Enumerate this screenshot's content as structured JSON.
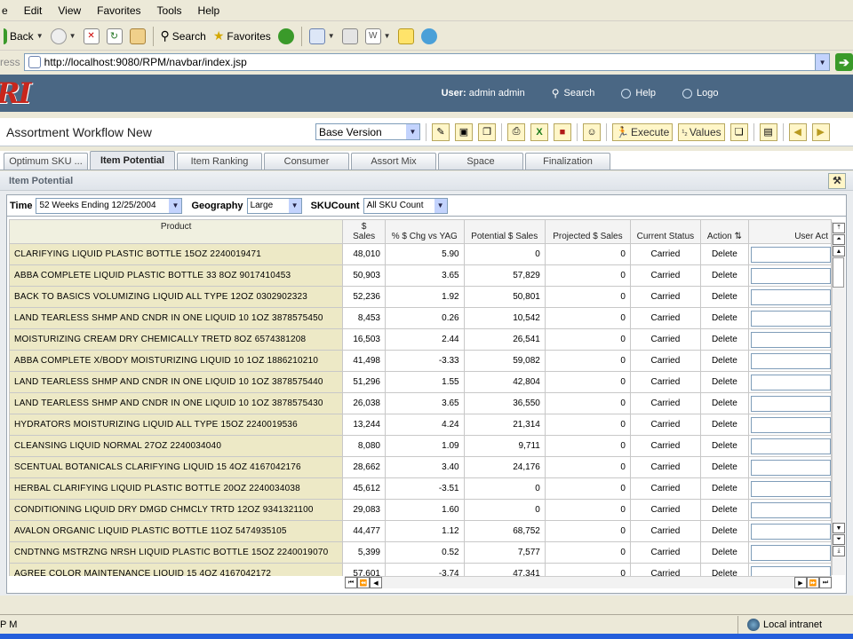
{
  "menu": [
    "e",
    "Edit",
    "View",
    "Favorites",
    "Tools",
    "Help"
  ],
  "toolbar": {
    "back": "Back",
    "search": "Search",
    "favorites": "Favorites"
  },
  "address": {
    "label": "ress",
    "url": "http://localhost:9080/RPM/navbar/index.jsp"
  },
  "header": {
    "logo": "RI",
    "user_label": "User:",
    "user_name": "admin admin",
    "search": "Search",
    "help": "Help",
    "logout": "Logo"
  },
  "title": "Assortment Workflow New",
  "version": "Base Version",
  "buttons": {
    "execute": "Execute",
    "values": "Values"
  },
  "tabs": [
    "Optimum SKU ...",
    "Item Potential",
    "Item Ranking",
    "Consumer",
    "Assort Mix",
    "Space",
    "Finalization"
  ],
  "active_tab": "Item Potential",
  "section_title": "Item Potential",
  "filters": {
    "time_label": "Time",
    "time_value": "52 Weeks Ending 12/25/2004",
    "geo_label": "Geography",
    "geo_value": "Large",
    "sku_label": "SKUCount",
    "sku_value": "All SKU Count"
  },
  "columns": {
    "product": "Product",
    "sales_top": "$",
    "sales_bottom": "Sales",
    "chg": "% $ Chg vs YAG",
    "potential": "Potential $ Sales",
    "projected": "Projected $ Sales",
    "status": "Current Status",
    "action": "Action",
    "user_action": "User Act"
  },
  "rows": [
    [
      "CLARIFYING LIQUID PLASTIC BOTTLE 15OZ 2240019471",
      "48,010",
      "5.90",
      "0",
      "0",
      "Carried",
      "Delete"
    ],
    [
      "ABBA COMPLETE LIQUID PLASTIC BOTTLE 33 8OZ 9017410453",
      "50,903",
      "3.65",
      "57,829",
      "0",
      "Carried",
      "Delete"
    ],
    [
      "BACK TO BASICS VOLUMIZING LIQUID ALL TYPE 12OZ 0302902323",
      "52,236",
      "1.92",
      "50,801",
      "0",
      "Carried",
      "Delete"
    ],
    [
      "LAND TEARLESS SHMP AND CNDR IN ONE LIQUID 10 1OZ 3878575450",
      "8,453",
      "0.26",
      "10,542",
      "0",
      "Carried",
      "Delete"
    ],
    [
      "MOISTURIZING CREAM DRY CHEMICALLY TRETD 8OZ 6574381208",
      "16,503",
      "2.44",
      "26,541",
      "0",
      "Carried",
      "Delete"
    ],
    [
      "ABBA COMPLETE X/BODY MOISTURIZING LIQUID 10 1OZ 1886210210",
      "41,498",
      "-3.33",
      "59,082",
      "0",
      "Carried",
      "Delete"
    ],
    [
      "LAND TEARLESS SHMP AND CNDR IN ONE LIQUID 10 1OZ 3878575440",
      "51,296",
      "1.55",
      "42,804",
      "0",
      "Carried",
      "Delete"
    ],
    [
      "LAND TEARLESS SHMP AND CNDR IN ONE LIQUID 10 1OZ 3878575430",
      "26,038",
      "3.65",
      "36,550",
      "0",
      "Carried",
      "Delete"
    ],
    [
      "HYDRATORS MOISTURIZING LIQUID ALL TYPE 15OZ 2240019536",
      "13,244",
      "4.24",
      "21,314",
      "0",
      "Carried",
      "Delete"
    ],
    [
      "CLEANSING LIQUID NORMAL 27OZ 2240034040",
      "8,080",
      "1.09",
      "9,711",
      "0",
      "Carried",
      "Delete"
    ],
    [
      "SCENTUAL BOTANICALS CLARIFYING LIQUID 15 4OZ 4167042176",
      "28,662",
      "3.40",
      "24,176",
      "0",
      "Carried",
      "Delete"
    ],
    [
      "HERBAL CLARIFYING LIQUID PLASTIC BOTTLE 20OZ 2240034038",
      "45,612",
      "-3.51",
      "0",
      "0",
      "Carried",
      "Delete"
    ],
    [
      "CONDITIONING LIQUID DRY DMGD CHMCLY TRTD 12OZ 9341321100",
      "29,083",
      "1.60",
      "0",
      "0",
      "Carried",
      "Delete"
    ],
    [
      "AVALON ORGANIC LIQUID PLASTIC BOTTLE 11OZ 5474935105",
      "44,477",
      "1.12",
      "68,752",
      "0",
      "Carried",
      "Delete"
    ],
    [
      "CNDTNNG MSTRZNG NRSH LIQUID PLASTIC BOTTLE 15OZ 2240019070",
      "5,399",
      "0.52",
      "7,577",
      "0",
      "Carried",
      "Delete"
    ],
    [
      "AGREE COLOR MAINTENANCE LIQUID 15 4OZ 4167042172",
      "57,601",
      "-3.74",
      "47,341",
      "0",
      "Carried",
      "Delete"
    ]
  ],
  "status": {
    "left": "P M",
    "zone": "Local intranet"
  },
  "colors": {
    "header_bg": "#4a6784",
    "product_cell": "#ede9c6",
    "logo_red": "#c8261c"
  }
}
